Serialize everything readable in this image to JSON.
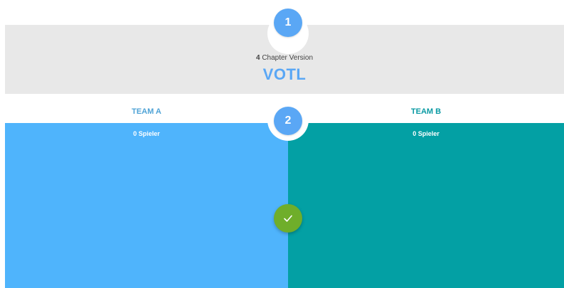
{
  "steps": {
    "step1": "1",
    "step2": "2"
  },
  "version": {
    "chapter_count": "4",
    "chapter_label": "Chapter Version",
    "title": "VOTL"
  },
  "teams": [
    {
      "name": "TEAM A",
      "players": "0 Spieler",
      "color": "#4fb4fc",
      "label_color": "#4fa3d6"
    },
    {
      "name": "TEAM B",
      "players": "0 Spieler",
      "color": "#03a0a4",
      "label_color": "#0a9aa3"
    }
  ],
  "confirm": {
    "icon": "check-icon",
    "color": "#6fae2a"
  },
  "colors": {
    "accent": "#5aa7f5",
    "panel_bg": "#e8e8e8"
  }
}
